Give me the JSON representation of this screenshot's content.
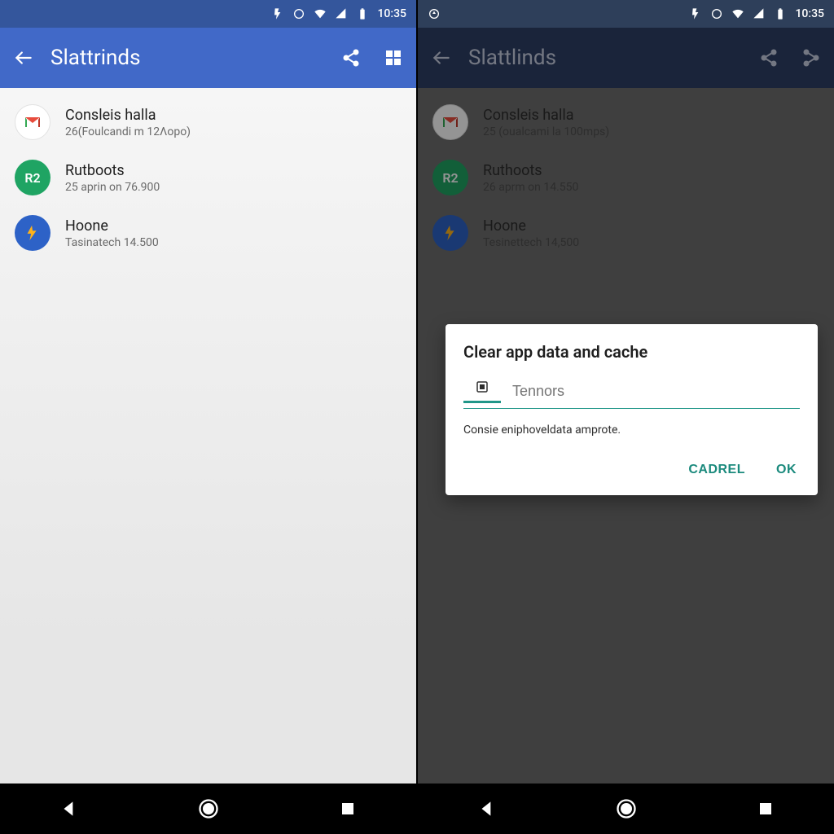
{
  "status": {
    "time": "10:35"
  },
  "appbar": {
    "title_left": "Slattrinds",
    "title_right": "Slattlinds"
  },
  "apps": [
    {
      "title": "Consleis halla",
      "sub_left": "26(Foulcandi m 12Λopo)",
      "sub_right": "25 (oualcami la 100mps)",
      "r2": "R2"
    },
    {
      "title_left": "Rutboots",
      "title_right": "Ruthoots",
      "sub_left": "25 aprin on 76.900",
      "sub_right": "26 aprm on 14.550",
      "r2": "R2"
    },
    {
      "title": "Hoone",
      "sub_left": "Tasinatech 14.500",
      "sub_right": "Tesinettech 14,500"
    }
  ],
  "dialog": {
    "title": "Clear app data and cache",
    "placeholder": "Tennors",
    "hint": "Consie eniphoveldata amprote.",
    "cancel": "CADREL",
    "ok": "OK"
  }
}
